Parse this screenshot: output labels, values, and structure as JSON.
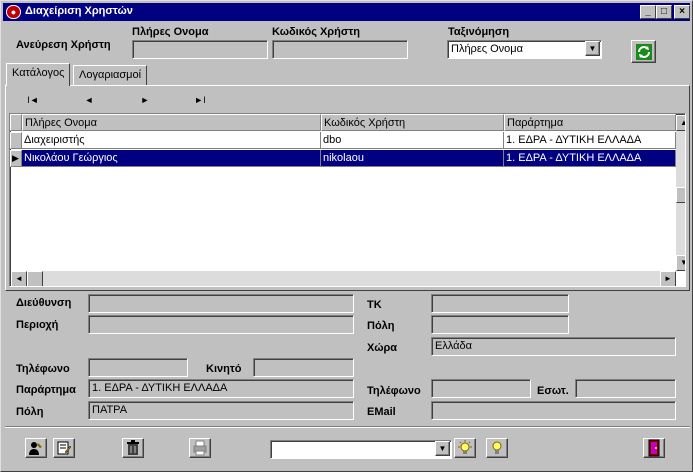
{
  "window": {
    "title": "Διαχείριση Χρηστών",
    "icon": "app-logo-icon",
    "controls": {
      "minimize": "_",
      "maximize": "□",
      "close": "×"
    }
  },
  "search": {
    "label": "Ανεύρεση Χρήστη",
    "fullname_label": "Πλήρες Ονομα",
    "fullname_value": "",
    "code_label": "Κωδικός Χρήστη",
    "code_value": "",
    "sort_label": "Ταξινόμηση",
    "sort_value": "Πλήρες Ονομα"
  },
  "tabs": [
    {
      "label": "Κατάλογος",
      "active": true
    },
    {
      "label": "Λογαριασμοί",
      "active": false
    }
  ],
  "navigator": {
    "first": "I◄",
    "prev": "◄",
    "next": "►",
    "last": "►I"
  },
  "grid": {
    "columns": [
      "Πλήρες Ονομα",
      "Κωδικός Χρήστη",
      "Παράρτημα"
    ],
    "rows": [
      {
        "cells": [
          "Διαχειριστής",
          "dbo",
          "1. ΕΔΡΑ - ΔΥΤΙΚΗ ΕΛΛΑΔΑ"
        ],
        "selected": false
      },
      {
        "cells": [
          "Νικολάου Γεώργιος",
          "nikolaou",
          "1. ΕΔΡΑ - ΔΥΤΙΚΗ ΕΛΛΑΔΑ"
        ],
        "selected": true
      }
    ]
  },
  "details": {
    "address_label": "Διεύθυνση",
    "address_value": "",
    "area_label": "Περιοχή",
    "area_value": "",
    "zip_label": "ΤΚ",
    "zip_value": "",
    "city_label": "Πόλη",
    "city_value": "",
    "country_label": "Χώρα",
    "country_value": "Ελλάδα",
    "phone_label": "Τηλέφωνο",
    "phone_value": "",
    "mobile_label": "Κινητό",
    "mobile_value": "",
    "branch_label": "Παράρτημα",
    "branch_value": "1. ΕΔΡΑ - ΔΥΤΙΚΗ ΕΛΛΑΔΑ",
    "branch_city_label": "Πόλη",
    "branch_city_value": "ΠΑΤΡΑ",
    "branch_phone_label": "Τηλέφωνο",
    "branch_phone_value": "",
    "ext_label": "Εσωτ.",
    "ext_value": "",
    "email_label": "EMail",
    "email_value": ""
  },
  "toolbar": {
    "dropdown_value": "",
    "icons": [
      "edit-user-icon",
      "edit-note-icon",
      "trash-icon",
      "printer-icon",
      "bulb-on-icon",
      "bulb-icon",
      "exit-door-icon"
    ]
  }
}
